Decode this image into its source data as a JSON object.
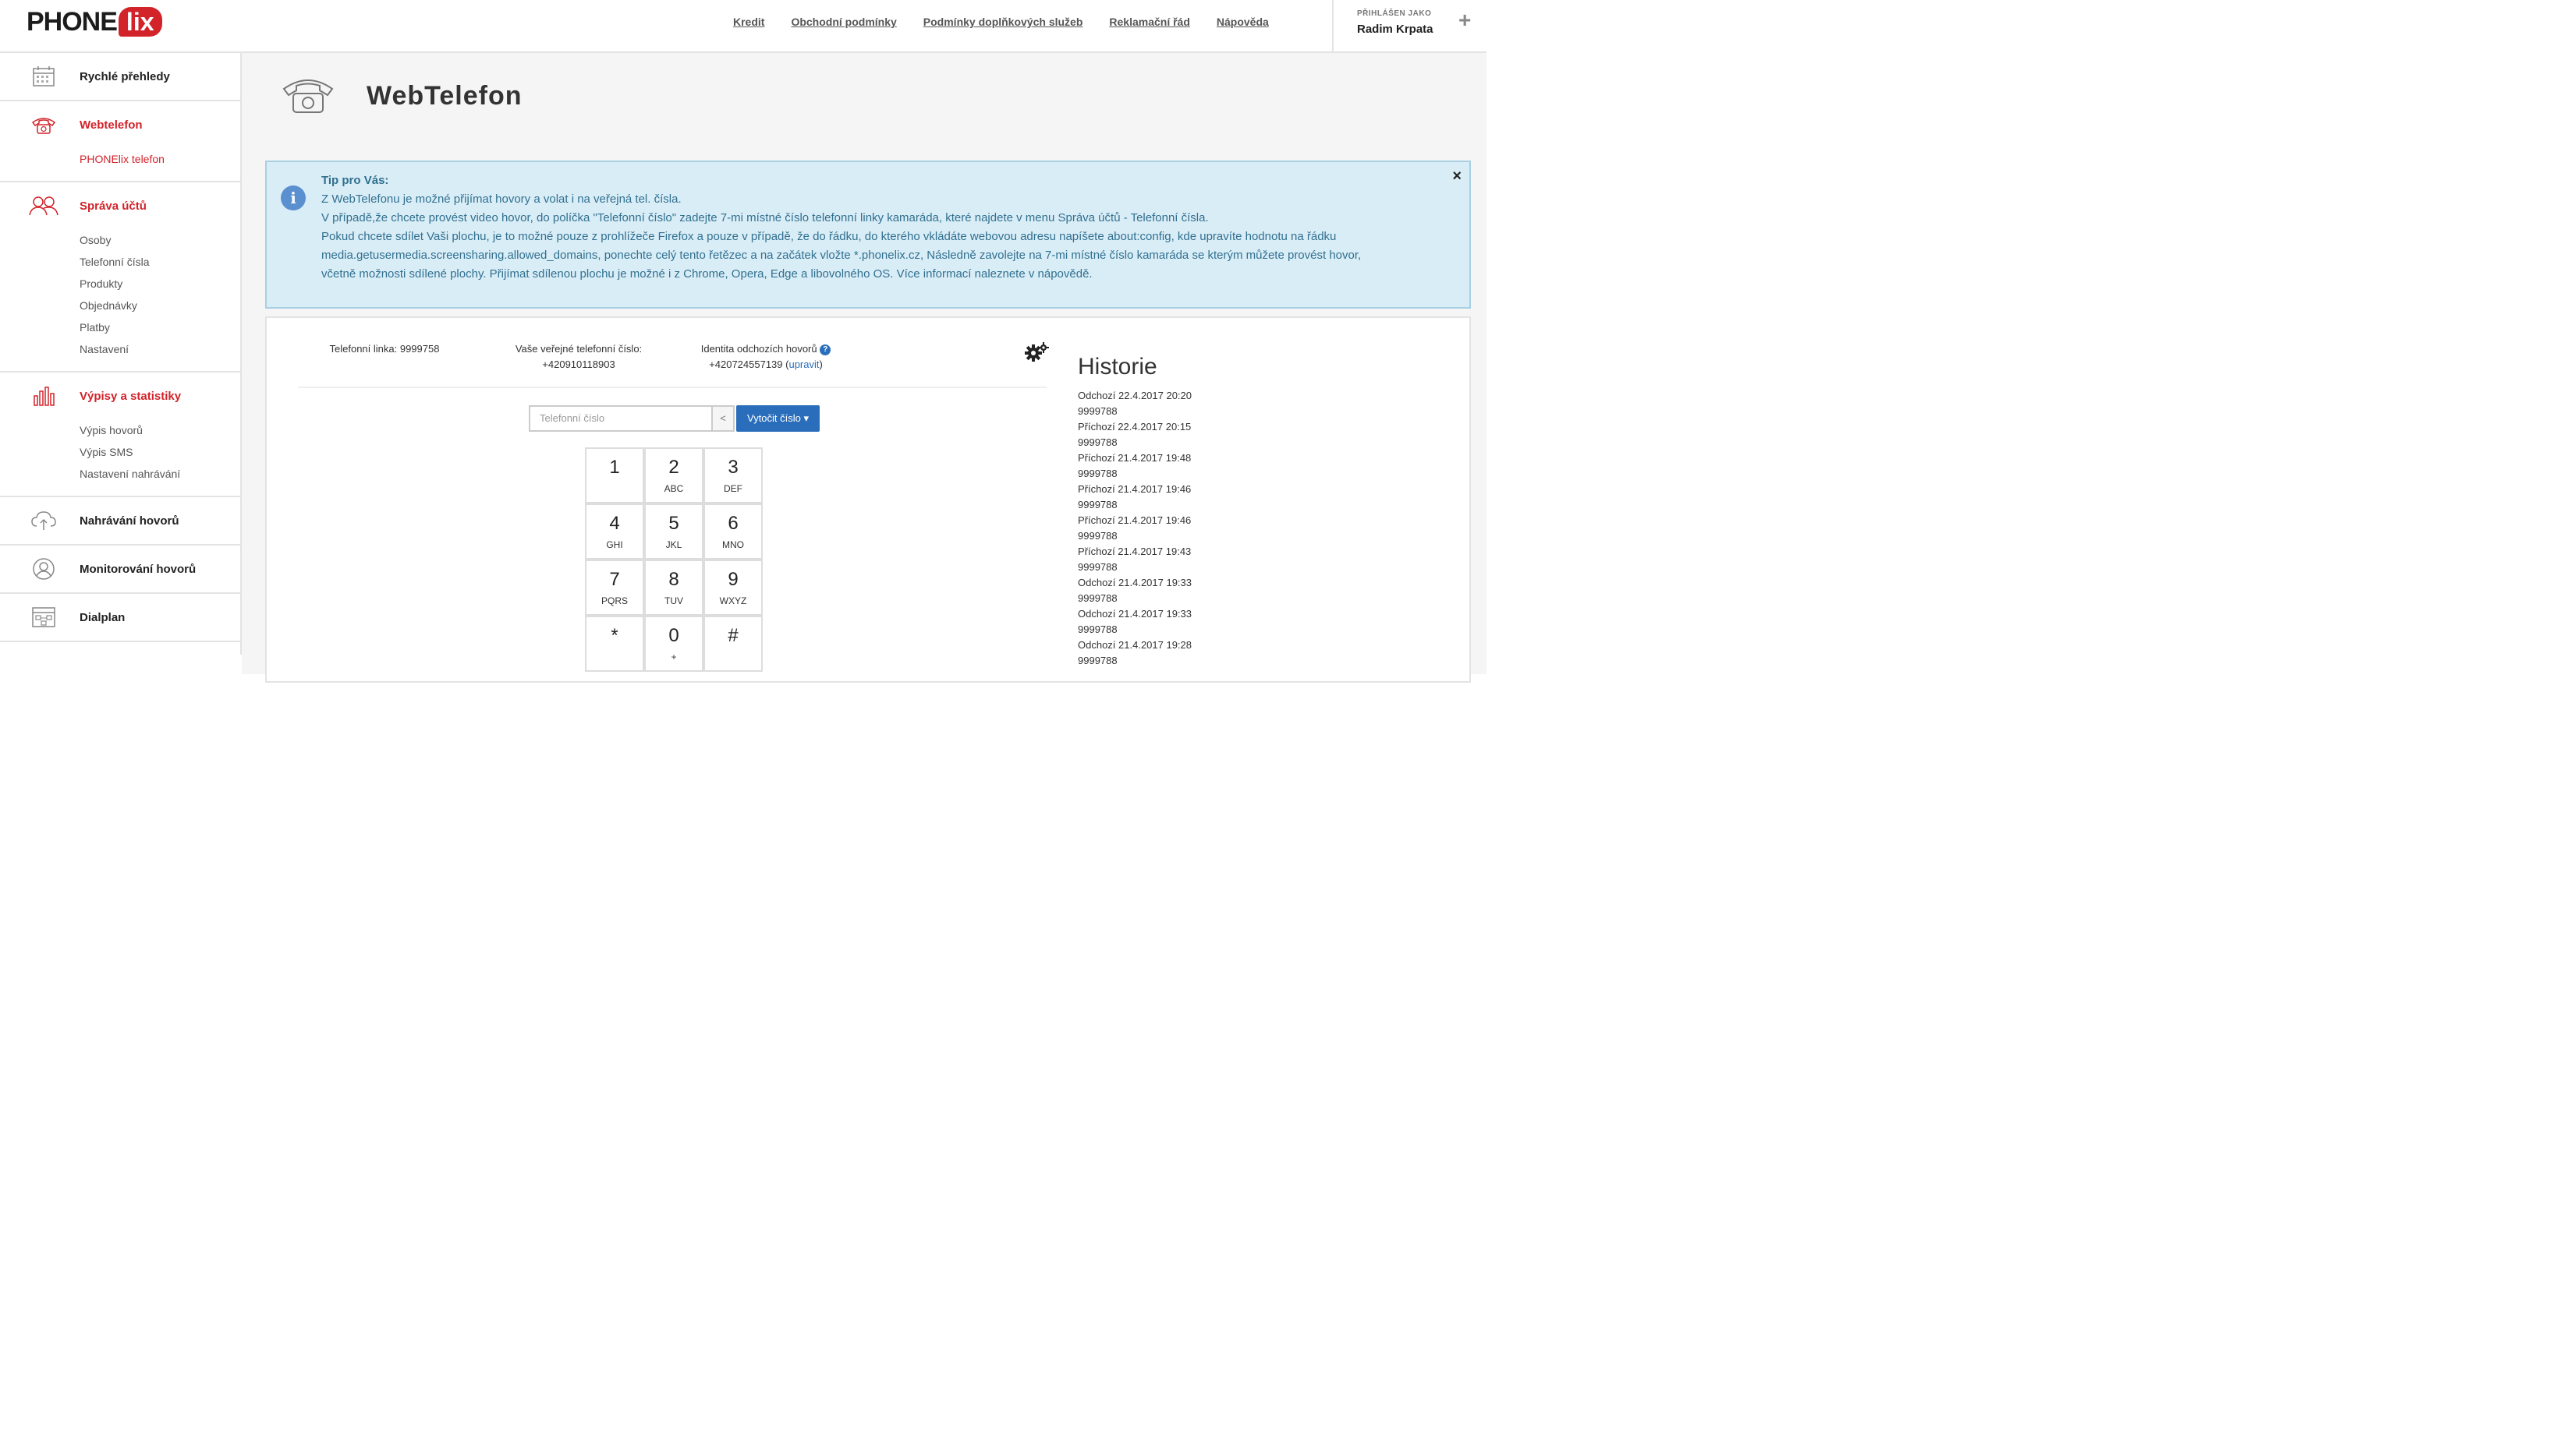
{
  "header": {
    "logo_main": "PHONE",
    "logo_badge": "lix",
    "nav": [
      "Kredit",
      "Obchodní podmínky",
      "Podmínky doplňkových služeb",
      "Reklamační řád",
      "Nápověda"
    ],
    "user_caption": "PŘIHLÁŠEN JAKO",
    "user_name": "Radim Krpata",
    "plus_icon": "+"
  },
  "sidebar": {
    "sections": [
      {
        "label": "Rychlé přehledy",
        "icon": "calendar-icon",
        "active": false,
        "items": []
      },
      {
        "label": "Webtelefon",
        "icon": "phone-icon",
        "active": true,
        "items": [
          "PHONElix telefon"
        ]
      },
      {
        "label": "Správa účtů",
        "icon": "users-icon",
        "active": true,
        "items": [
          "Osoby",
          "Telefonní čísla",
          "Produkty",
          "Objednávky",
          "Platby",
          "Nastavení"
        ]
      },
      {
        "label": "Výpisy a statistiky",
        "icon": "bar-chart-icon",
        "active": true,
        "items": [
          "Výpis hovorů",
          "Výpis SMS",
          "Nastavení nahrávání"
        ]
      },
      {
        "label": "Nahrávání hovorů",
        "icon": "cloud-upload-icon",
        "active": false,
        "items": []
      },
      {
        "label": "Monitorování hovorů",
        "icon": "user-circle-icon",
        "active": false,
        "items": []
      },
      {
        "label": "Dialplan",
        "icon": "dialplan-icon",
        "active": false,
        "items": []
      }
    ]
  },
  "page": {
    "title": "WebTelefon"
  },
  "tip": {
    "title": "Tip pro Vás:",
    "lines": [
      "Z WebTelefonu je možné přijímat hovory a volat i na veřejná tel. čísla.",
      "V případě,že chcete provést video hovor, do políčka \"Telefonní číslo\" zadejte 7-mi místné číslo telefonní linky kamaráda, které najdete v menu Správa účtů - Telefonní čísla.",
      "Pokud chcete sdílet Vaši plochu, je to možné pouze z prohlížeče Firefox a pouze v případě, že do řádku, do kterého vkládáte webovou adresu napíšete about:config, kde upravíte hodnotu na řádku",
      "media.getusermedia.screensharing.allowed_domains, ponechte celý tento řetězec a na začátek vložte *.phonelix.cz, Následně zavolejte na 7-mi místné číslo kamaráda se kterým můžete provést hovor,",
      "včetně možnosti sdílené plochy. Přijímat sdílenou plochu je možné i z Chrome, Opera, Edge a libovolného OS. Více informací naleznete v nápovědě."
    ],
    "close": "×"
  },
  "phone": {
    "line_label": "Telefonní linka: 9999758",
    "public_label": "Vaše veřejné telefonní číslo:",
    "public_number": "+420910118903",
    "identity_label": "Identita odchozích hovorů",
    "identity_number": "+420724557139",
    "identity_edit": "upravit",
    "input_placeholder": "Telefonní číslo",
    "backspace": "<",
    "call_button": "Vytočit číslo ▾",
    "keys": [
      {
        "num": "1",
        "letters": ""
      },
      {
        "num": "2",
        "letters": "ABC"
      },
      {
        "num": "3",
        "letters": "DEF"
      },
      {
        "num": "4",
        "letters": "GHI"
      },
      {
        "num": "5",
        "letters": "JKL"
      },
      {
        "num": "6",
        "letters": "MNO"
      },
      {
        "num": "7",
        "letters": "PQRS"
      },
      {
        "num": "8",
        "letters": "TUV"
      },
      {
        "num": "9",
        "letters": "WXYZ"
      },
      {
        "num": "*",
        "letters": ""
      },
      {
        "num": "0",
        "letters": "+"
      },
      {
        "num": "#",
        "letters": ""
      }
    ]
  },
  "history": {
    "title": "Historie",
    "items": [
      "Odchozí 22.4.2017 20:20",
      "9999788",
      "Příchozí 22.4.2017 20:15",
      "9999788",
      "Příchozí 21.4.2017 19:48",
      "9999788",
      "Příchozí 21.4.2017 19:46",
      "9999788",
      "Příchozí 21.4.2017 19:46",
      "9999788",
      "Příchozí 21.4.2017 19:43",
      "9999788",
      "Odchozí 21.4.2017 19:33",
      "9999788",
      "Odchozí 21.4.2017 19:33",
      "9999788",
      "Odchozí 21.4.2017 19:28",
      "9999788"
    ]
  },
  "colors": {
    "accent_red": "#d2232a",
    "link_blue": "#2a6ebb",
    "tip_bg": "#d9edf7",
    "tip_text": "#31708f"
  }
}
